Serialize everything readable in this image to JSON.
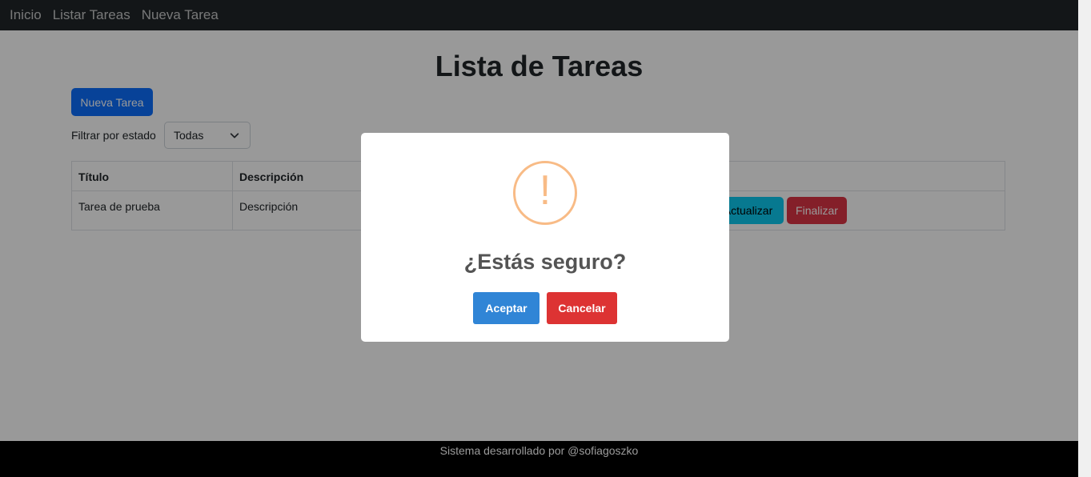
{
  "navbar": {
    "links": [
      "Inicio",
      "Listar Tareas",
      "Nueva Tarea"
    ]
  },
  "page": {
    "title": "Lista de Tareas",
    "new_task_button": "Nueva Tarea",
    "filter_label": "Filtrar por estado",
    "filter_value": "Todas"
  },
  "table": {
    "headers": [
      "Título",
      "Descripción"
    ],
    "rows": [
      {
        "title": "Tarea de prueba",
        "description": "Descripción",
        "update_label": "Actualizar",
        "finish_label": "Finalizar"
      }
    ]
  },
  "footer": {
    "text": "Sistema desarrollado por @sofiagoszko"
  },
  "modal": {
    "icon": "warning-icon",
    "icon_glyph": "!",
    "title": "¿Estás seguro?",
    "accept_label": "Aceptar",
    "cancel_label": "Cancelar"
  },
  "colors": {
    "primary": "#0d6efd",
    "info": "#0dcaf0",
    "danger": "#dc3545",
    "modal_accept": "#3085d6",
    "modal_cancel": "#dd3333",
    "warning": "#f8bb86"
  }
}
